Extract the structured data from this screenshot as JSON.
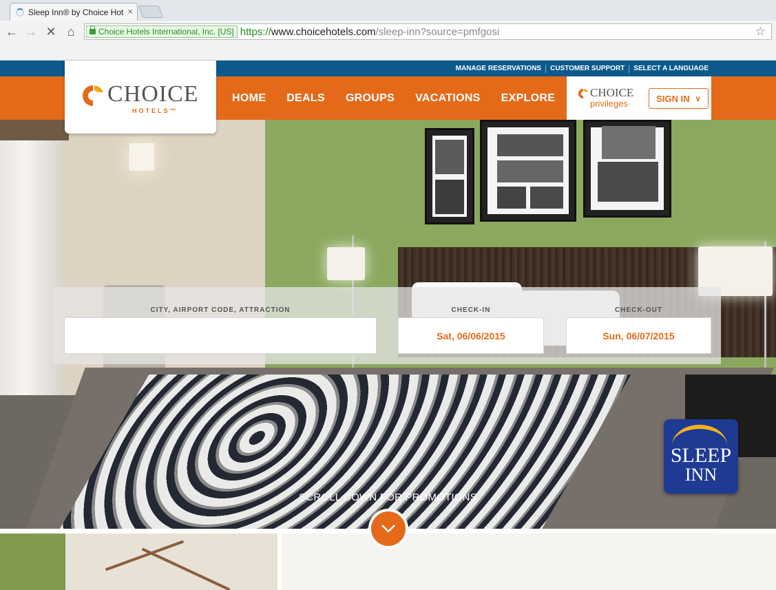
{
  "browser": {
    "tab_title": "Sleep Inn® by Choice Hot",
    "tab_close": "×",
    "ev_org": "Choice Hotels International, Inc. [US]",
    "url_scheme": "https://",
    "url_host": "www.choicehotels.com",
    "url_path": "/sleep-inn?source=pmfgosi",
    "icons": [
      "back-icon",
      "forward-icon",
      "stop-icon",
      "home-icon",
      "lock-icon",
      "star-icon"
    ]
  },
  "topbar": {
    "links": [
      "MANAGE RESERVATIONS",
      "CUSTOMER SUPPORT",
      "SELECT A LANGUAGE"
    ]
  },
  "logo": {
    "word": "CHOICE",
    "sub": "HOTELS™"
  },
  "nav": {
    "items": [
      "HOME",
      "DEALS",
      "GROUPS",
      "VACATIONS",
      "EXPLORE"
    ]
  },
  "privileges": {
    "word": "CHOICE",
    "sub": "privileges·",
    "signin_label": "SIGN IN"
  },
  "booking": {
    "destination_label": "CITY, AIRPORT CODE, ATTRACTION",
    "destination_value": "",
    "checkin_label": "CHECK-IN",
    "checkin_value": "Sat, 06/06/2015",
    "checkout_label": "CHECK-OUT",
    "checkout_value": "Sun, 06/07/2015"
  },
  "brand_badge": {
    "line1": "SLEEP",
    "line2": "INN"
  },
  "scroll": {
    "text": "SCROLL DOWN FOR PROMOTIONS"
  },
  "colors": {
    "brand_orange": "#e46a1a",
    "brand_blue": "#0c5a8c",
    "sleep_blue": "#1e3a93"
  }
}
